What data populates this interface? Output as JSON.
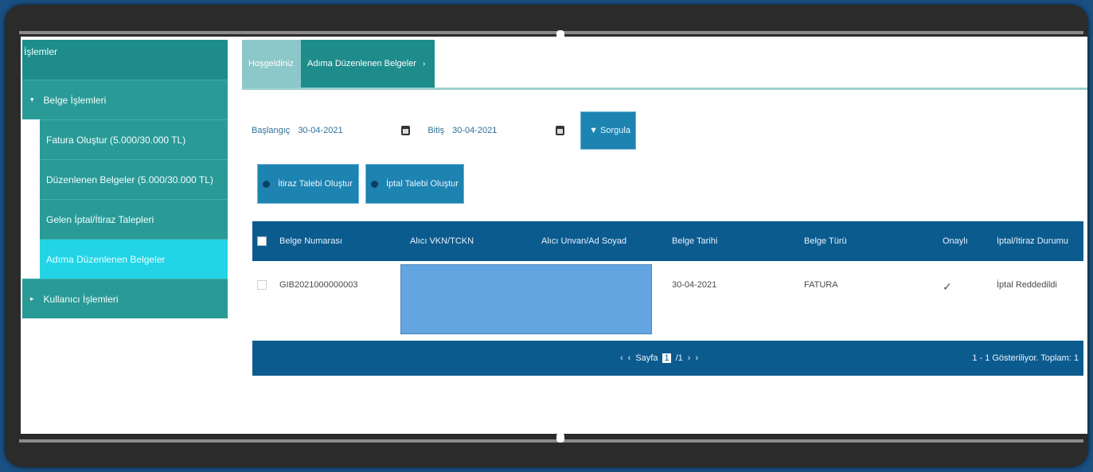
{
  "sidebar": {
    "header": "İşlemler",
    "items": [
      {
        "label": "Belge İşlemleri",
        "type": "group",
        "caret": "▾"
      },
      {
        "label": "Fatura Oluştur (5.000/30.000 TL)",
        "type": "sub"
      },
      {
        "label": "Düzenlenen Belgeler (5.000/30.000 TL)",
        "type": "sub"
      },
      {
        "label": "Gelen İptal/İtiraz Talepleri",
        "type": "sub"
      },
      {
        "label": "Adıma Düzenlenen Belgeler",
        "type": "sub",
        "active": true
      },
      {
        "label": "Kullanıcı İşlemleri",
        "type": "group",
        "caret": "▸"
      }
    ]
  },
  "breadcrumb": {
    "home": "Hoşgeldiniz",
    "current": "Adıma Düzenlenen Belgeler",
    "chevron": "›"
  },
  "filters": {
    "start_label": "Başlangıç",
    "start_value": "30-04-2021",
    "end_label": "Bitiş",
    "end_value": "30-04-2021",
    "filter_button": "▼ Sorgula"
  },
  "actions": {
    "objection_button": "İtiraz Talebi Oluştur",
    "cancel_button": "İptal Talebi Oluştur"
  },
  "table": {
    "headers": [
      "Belge Numarası",
      "Alıcı VKN/TCKN",
      "Alıcı Unvan/Ad Soyad",
      "Belge Tarihi",
      "Belge Türü",
      "Onaylı",
      "İptal/İtiraz Durumu"
    ],
    "rows": [
      {
        "number": "GIB2021000000003",
        "date": "30-04-2021",
        "type": "FATURA",
        "approved": "✓",
        "status": "İptal Reddedildi"
      }
    ]
  },
  "pager": {
    "first": "‹",
    "prev": "‹",
    "page_label": "Sayfa",
    "page": "1",
    "total": "/1",
    "next": "›",
    "last": "›",
    "info": "1 - 1 Gösteriliyor. Toplam: 1"
  },
  "colors": {
    "sidebar": "#2a9a97",
    "sidebar_active": "#22d4e6",
    "table_header": "#0c5b8e",
    "button": "#1d83b1",
    "mask": "#63a5e0"
  }
}
